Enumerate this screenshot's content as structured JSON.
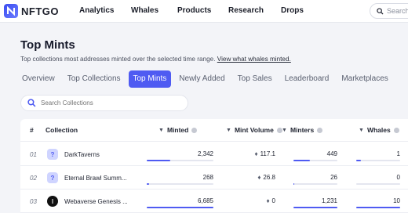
{
  "brand": {
    "name": "NFTGO",
    "accent": "#4f5bf2"
  },
  "nav": {
    "items": [
      "Analytics",
      "Whales",
      "Products",
      "Research",
      "Drops"
    ],
    "search_placeholder": "Search"
  },
  "page": {
    "title": "Top Mints",
    "subtitle": "Top collections most addresses minted over the selected time range.",
    "subtitle_link": "View what whales minted."
  },
  "tabs": [
    {
      "label": "Overview",
      "active": false
    },
    {
      "label": "Top Collections",
      "active": false
    },
    {
      "label": "Top Mints",
      "active": true
    },
    {
      "label": "Newly Added",
      "active": false
    },
    {
      "label": "Top Sales",
      "active": false
    },
    {
      "label": "Leaderboard",
      "active": false
    },
    {
      "label": "Marketplaces",
      "active": false
    }
  ],
  "search": {
    "placeholder": "Search Collections"
  },
  "table": {
    "headers": {
      "index": "#",
      "collection": "Collection",
      "minted": "Minted",
      "mint_volume": "Mint Volume",
      "minters": "Minters",
      "whales": "Whales"
    },
    "rows": [
      {
        "index": "01",
        "name": "DarkTaverns",
        "avatar": "question-icon",
        "minted": "2,342",
        "minted_frac": 0.35,
        "mint_volume": "117.1",
        "minters": "449",
        "minters_frac": 0.37,
        "whales": "1",
        "whales_frac": 0.1
      },
      {
        "index": "02",
        "name": "Eternal Brawl Summ...",
        "avatar": "question-icon",
        "minted": "268",
        "minted_frac": 0.04,
        "mint_volume": "26.8",
        "minters": "26",
        "minters_frac": 0.02,
        "whales": "0",
        "whales_frac": 0.0
      },
      {
        "index": "03",
        "name": "Webaverse Genesis ...",
        "avatar": "dark-avatar",
        "minted": "6,685",
        "minted_frac": 1.0,
        "mint_volume": "0",
        "minters": "1,231",
        "minters_frac": 1.0,
        "whales": "10",
        "whales_frac": 1.0
      }
    ]
  }
}
